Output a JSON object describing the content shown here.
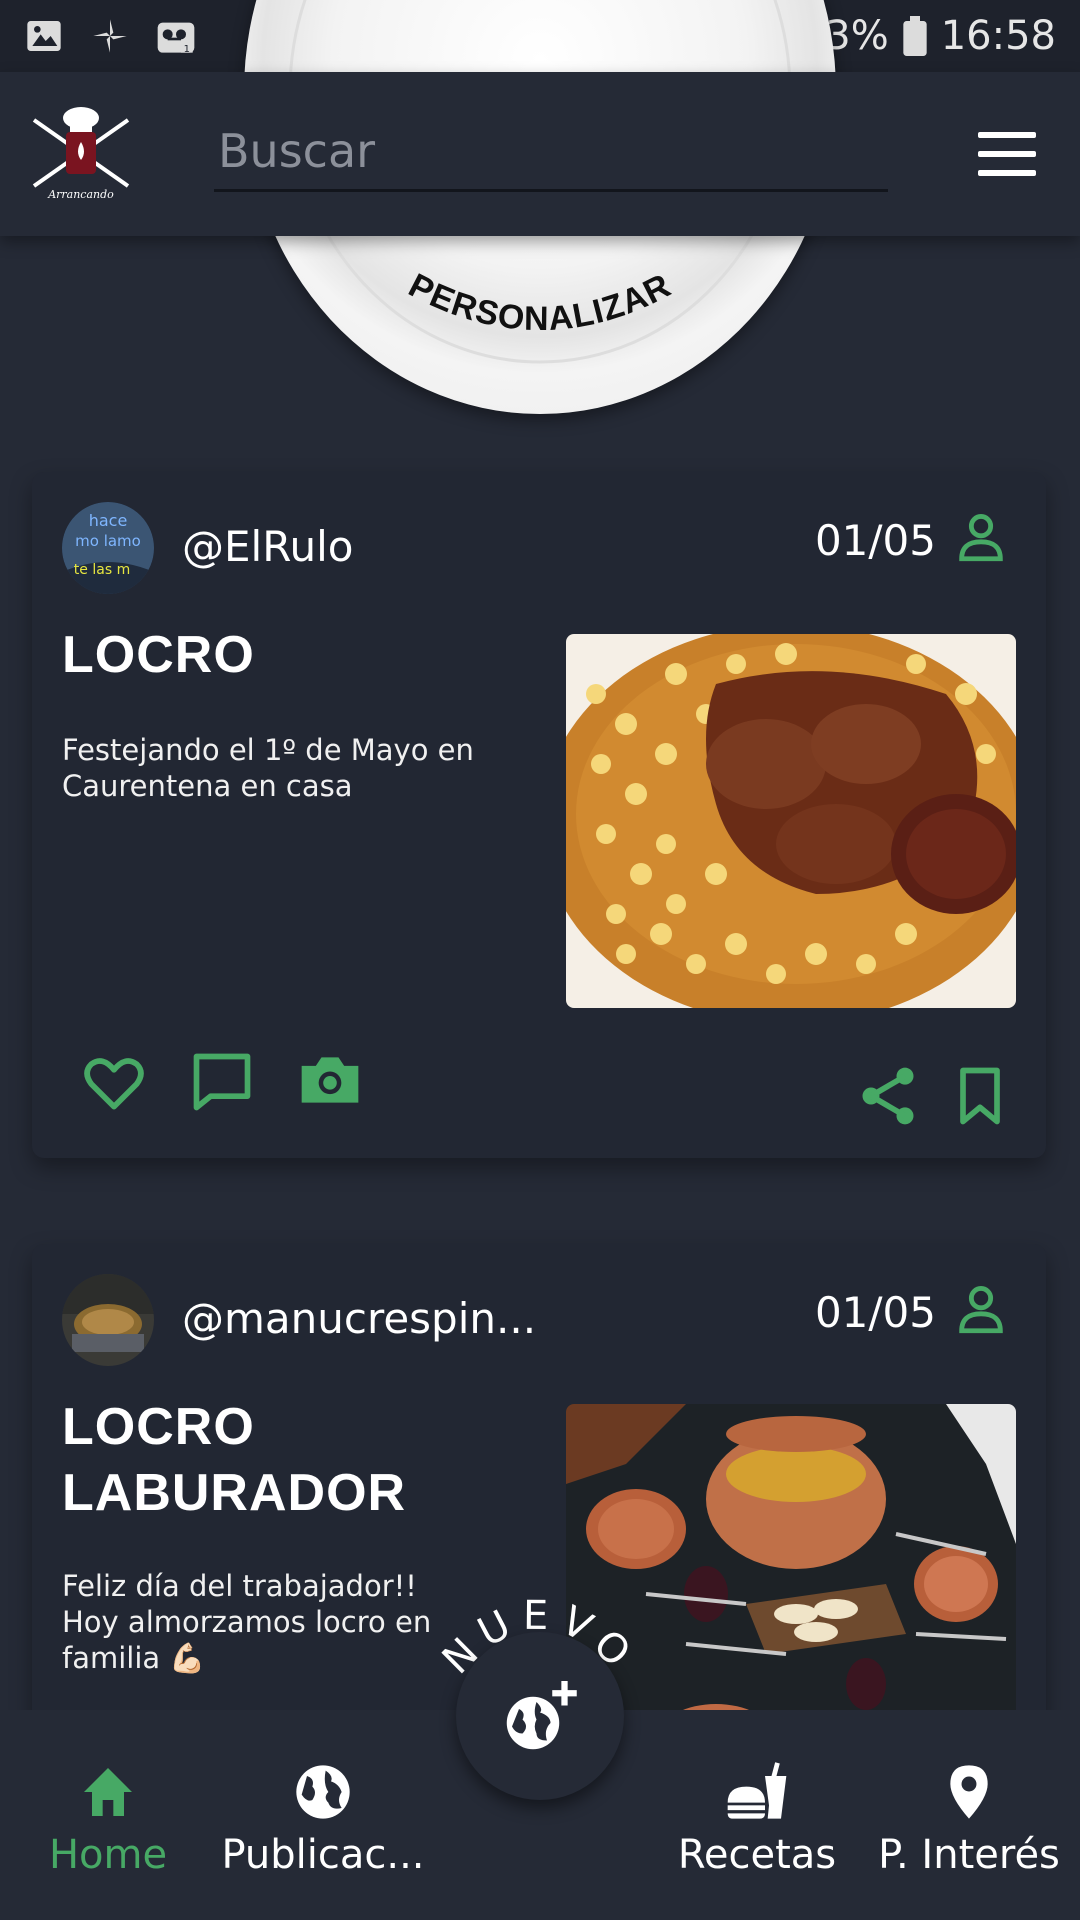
{
  "status_bar": {
    "battery": "83%",
    "time": "16:58"
  },
  "header": {
    "logo_text": "Arrancando",
    "search_placeholder": "Buscar"
  },
  "banner": {
    "label": "PERSONALIZAR"
  },
  "posts": [
    {
      "username": "@ElRulo",
      "date": "01/05",
      "title": "LOCRO",
      "description": "Festejando el 1º de Mayo en Caurentena en casa",
      "avatar_text": [
        "hace",
        "mo lamo",
        "te las m"
      ]
    },
    {
      "username": "@manucrespin...",
      "date": "01/05",
      "title": "LOCRO LABURADOR",
      "description": "Feliz día del trabajador!! Hoy almorzamos locro en familia 💪🏻"
    }
  ],
  "fab": {
    "label": "NUEVO"
  },
  "bottom_nav": [
    {
      "label": "Home",
      "icon": "home-icon",
      "active": true
    },
    {
      "label": "Publicac...",
      "icon": "globe-icon",
      "active": false
    },
    {
      "label": "Recetas",
      "icon": "fastfood-icon",
      "active": false
    },
    {
      "label": "P. Interés",
      "icon": "location-pin-icon",
      "active": false
    }
  ],
  "colors": {
    "accent": "#47a965",
    "background": "#252a36",
    "card": "#222733"
  }
}
